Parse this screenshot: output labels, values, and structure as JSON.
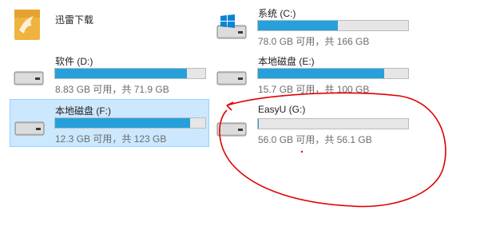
{
  "colors": {
    "bar_fill": "#26a0da",
    "bar_bg": "#e6e6e6",
    "selected_bg": "#cce8ff",
    "annotation": "#e00000"
  },
  "items": [
    {
      "kind": "folder",
      "name": "迅雷下载",
      "icon": "xunlei-folder-icon"
    },
    {
      "kind": "drive",
      "name": "系统 (C:)",
      "free_text": "78.0 GB 可用，共 166 GB",
      "used_fraction": 0.53,
      "icon": "windows-drive-icon"
    },
    {
      "kind": "drive",
      "name": "软件 (D:)",
      "free_text": "8.83 GB 可用，共 71.9 GB",
      "used_fraction": 0.88,
      "icon": "hard-drive-icon"
    },
    {
      "kind": "drive",
      "name": "本地磁盘 (E:)",
      "free_text": "15.7 GB 可用，共 100 GB",
      "used_fraction": 0.84,
      "icon": "hard-drive-icon"
    },
    {
      "kind": "drive",
      "name": "本地磁盘 (F:)",
      "free_text": "12.3 GB 可用，共 123 GB",
      "used_fraction": 0.9,
      "selected": true,
      "icon": "hard-drive-icon"
    },
    {
      "kind": "drive",
      "name": "EasyU (G:)",
      "free_text": "56.0 GB 可用，共 56.1 GB",
      "used_fraction": 0.002,
      "icon": "hard-drive-icon"
    }
  ]
}
